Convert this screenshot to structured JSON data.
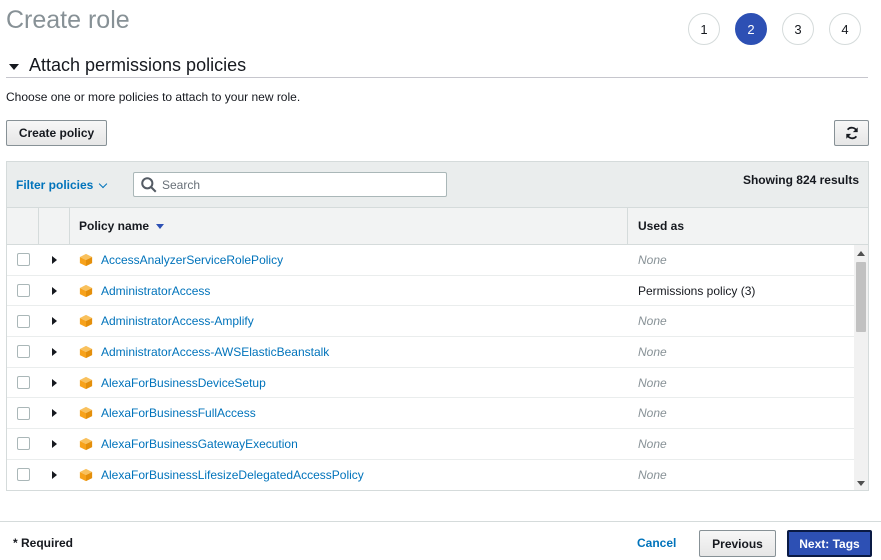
{
  "page_title": "Create role",
  "steps": [
    {
      "label": "1",
      "active": false
    },
    {
      "label": "2",
      "active": true
    },
    {
      "label": "3",
      "active": false
    },
    {
      "label": "4",
      "active": false
    }
  ],
  "section": {
    "title": "Attach permissions policies",
    "description": "Choose one or more policies to attach to your new role."
  },
  "toolbar": {
    "create_policy_label": "Create policy",
    "refresh_icon": "refresh-icon"
  },
  "filter": {
    "filter_label": "Filter policies",
    "search_placeholder": "Search",
    "results_text": "Showing 824 results"
  },
  "table": {
    "columns": {
      "name": "Policy name",
      "used_as": "Used as"
    },
    "rows": [
      {
        "name": "AccessAnalyzerServiceRolePolicy",
        "used_as": "None",
        "is_none": true
      },
      {
        "name": "AdministratorAccess",
        "used_as": "Permissions policy (3)",
        "is_none": false
      },
      {
        "name": "AdministratorAccess-Amplify",
        "used_as": "None",
        "is_none": true
      },
      {
        "name": "AdministratorAccess-AWSElasticBeanstalk",
        "used_as": "None",
        "is_none": true
      },
      {
        "name": "AlexaForBusinessDeviceSetup",
        "used_as": "None",
        "is_none": true
      },
      {
        "name": "AlexaForBusinessFullAccess",
        "used_as": "None",
        "is_none": true
      },
      {
        "name": "AlexaForBusinessGatewayExecution",
        "used_as": "None",
        "is_none": true
      },
      {
        "name": "AlexaForBusinessLifesizeDelegatedAccessPolicy",
        "used_as": "None",
        "is_none": true
      }
    ]
  },
  "footer": {
    "required_text": "* Required",
    "cancel_label": "Cancel",
    "previous_label": "Previous",
    "next_label": "Next: Tags"
  },
  "colors": {
    "accent": "#2d50b4",
    "link": "#0073bb",
    "policy_icon": "#f7a21b"
  }
}
